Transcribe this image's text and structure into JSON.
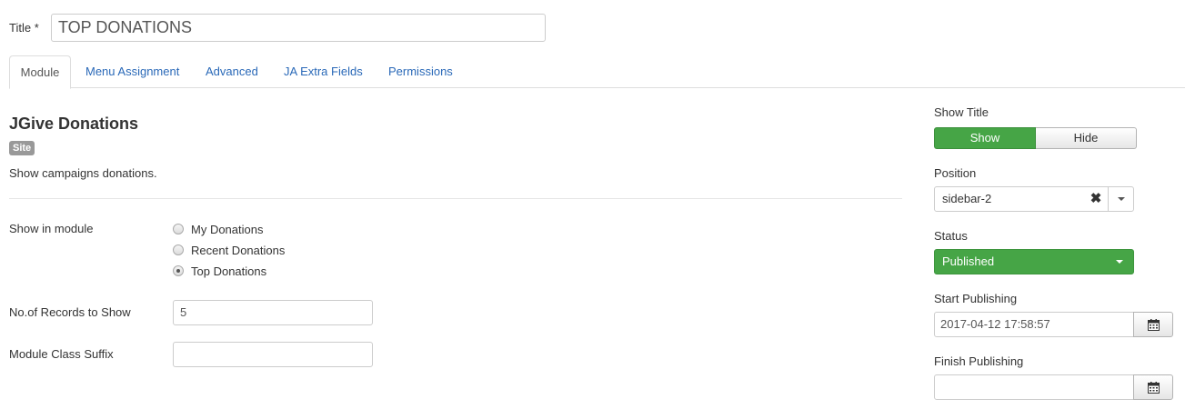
{
  "title_field": {
    "label": "Title *",
    "value": "TOP DONATIONS"
  },
  "tabs": [
    {
      "label": "Module",
      "active": true
    },
    {
      "label": "Menu Assignment",
      "active": false
    },
    {
      "label": "Advanced",
      "active": false
    },
    {
      "label": "JA Extra Fields",
      "active": false
    },
    {
      "label": "Permissions",
      "active": false
    }
  ],
  "module": {
    "name": "JGive Donations",
    "badge": "Site",
    "description": "Show campaigns donations."
  },
  "fields": {
    "show_in_module": {
      "label": "Show in module",
      "options": [
        {
          "label": "My Donations",
          "checked": false
        },
        {
          "label": "Recent Donations",
          "checked": false
        },
        {
          "label": "Top Donations",
          "checked": true
        }
      ]
    },
    "records": {
      "label": "No.of Records to Show",
      "value": "5"
    },
    "class_suffix": {
      "label": "Module Class Suffix",
      "value": ""
    }
  },
  "sidebar": {
    "show_title": {
      "label": "Show Title",
      "show_label": "Show",
      "hide_label": "Hide",
      "selected": "Show"
    },
    "position": {
      "label": "Position",
      "value": "sidebar-2"
    },
    "status": {
      "label": "Status",
      "value": "Published"
    },
    "start_publishing": {
      "label": "Start Publishing",
      "value": "2017-04-12 17:58:57"
    },
    "finish_publishing": {
      "label": "Finish Publishing",
      "value": ""
    }
  },
  "colors": {
    "accent_green": "#46a546",
    "link_blue": "#2a69b8",
    "badge_gray": "#999999"
  },
  "icons": {
    "clear": "close-icon",
    "dropdown": "chevron-down-icon",
    "calendar": "calendar-icon"
  }
}
